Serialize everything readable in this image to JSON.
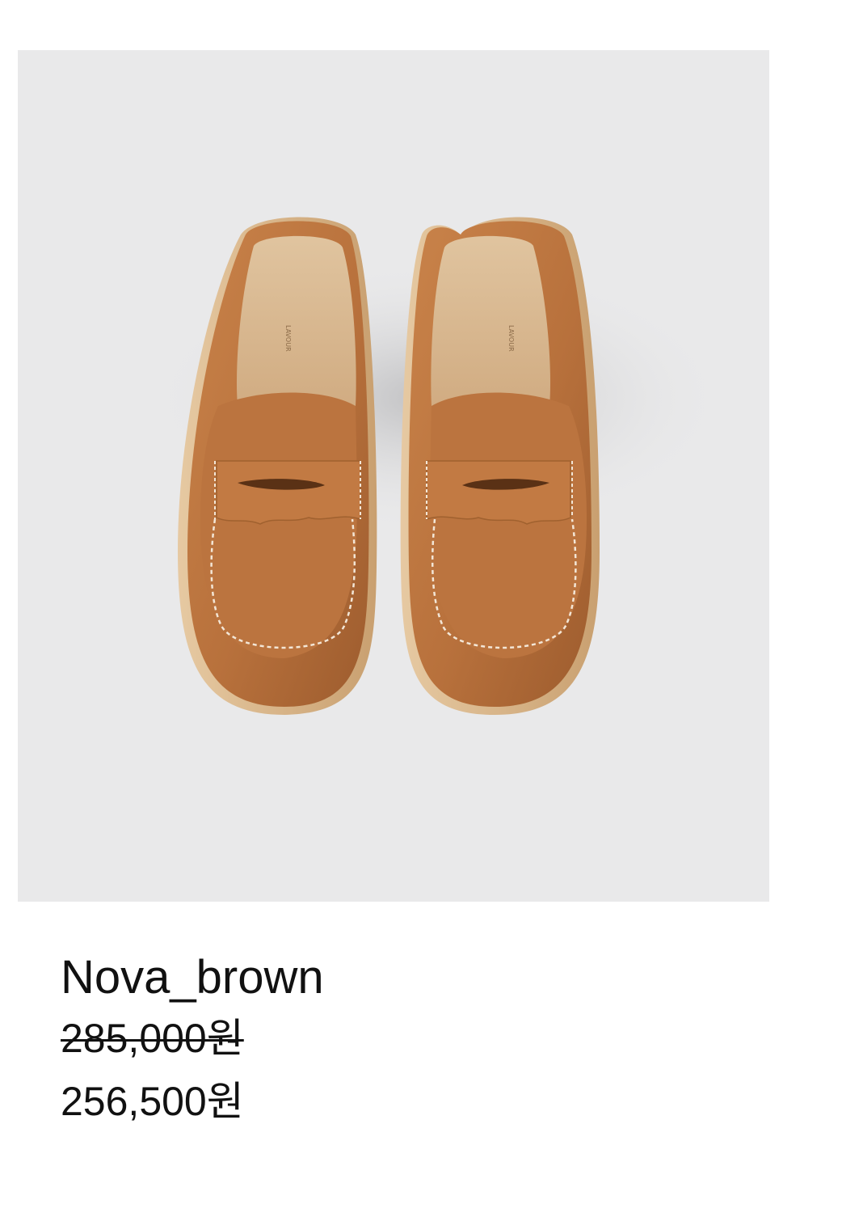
{
  "product": {
    "image_alt": "brown leather penny loafer mules",
    "name": "Nova_brown",
    "original_price": "285,000원",
    "sale_price": "256,500원",
    "colors": {
      "background": "#e9e9ea",
      "leather": "#b8713c",
      "insole": "#d9b88f",
      "sole": "#d8b185"
    }
  }
}
